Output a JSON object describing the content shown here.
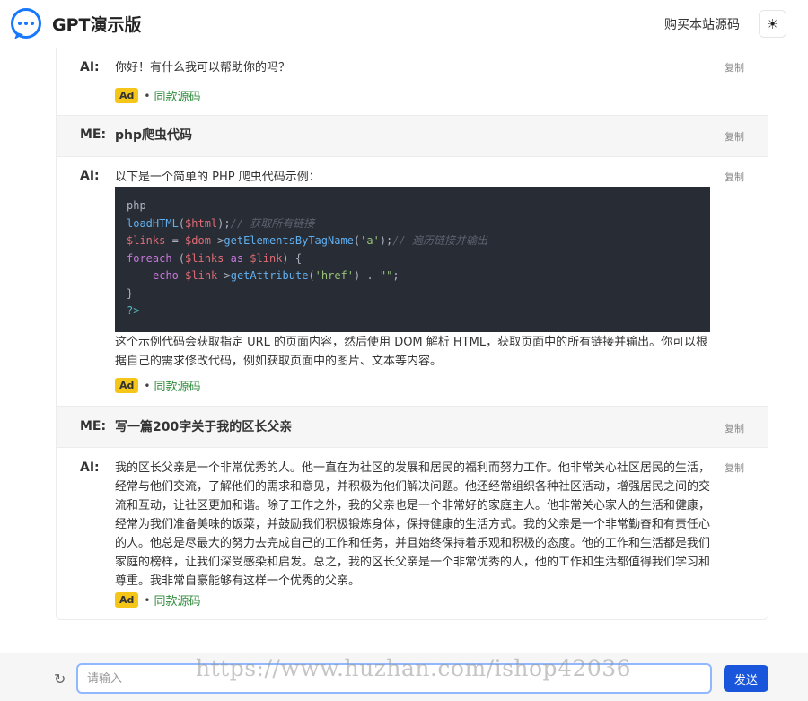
{
  "header": {
    "title": "GPT演示版",
    "buy_link": "购买本站源码",
    "theme_icon": "sun-icon"
  },
  "messages": [
    {
      "role": "AI:",
      "copy": "复制",
      "text": "你好！有什么我可以帮助你的吗？",
      "ad_badge": "Ad",
      "ad_dot": "•",
      "ad_link": "同款源码"
    },
    {
      "role": "ME:",
      "copy": "复制",
      "text": "php爬虫代码"
    },
    {
      "role": "AI:",
      "copy": "复制",
      "intro": "以下是一个简单的 PHP 爬虫代码示例：",
      "code": {
        "line1": "php",
        "line2_fn": "loadHTML",
        "line2_paren_open": "(",
        "line2_var": "$html",
        "line2_paren_close": ");",
        "line2_comment": "// 获取所有链接",
        "line3_var1": "$links",
        "line3_eq": " = ",
        "line3_var2": "$dom",
        "line3_arrow": "->",
        "line3_fn": "getElementsByTagName",
        "line3_open": "(",
        "line3_str": "'a'",
        "line3_close": ");",
        "line3_comment": "// 遍历链接并输出",
        "line4_kw": "foreach",
        "line4_open": " (",
        "line4_var1": "$links",
        "line4_as": " as ",
        "line4_var2": "$link",
        "line4_close": ") {",
        "line5_echo": "echo",
        "line5_var": "$link",
        "line5_arrow": "->",
        "line5_fn": "getAttribute",
        "line5_open": "(",
        "line5_str": "'href'",
        "line5_dot": ") . ",
        "line5_str2": "\"\"",
        "line5_end": ";",
        "line6": "}",
        "line7": "?>"
      },
      "outro": "这个示例代码会获取指定 URL 的页面内容，然后使用 DOM 解析 HTML，获取页面中的所有链接并输出。你可以根据自己的需求修改代码，例如获取页面中的图片、文本等内容。",
      "ad_badge": "Ad",
      "ad_dot": "•",
      "ad_link": "同款源码"
    },
    {
      "role": "ME:",
      "copy": "复制",
      "text": "写一篇200字关于我的区长父亲"
    },
    {
      "role": "AI:",
      "copy": "复制",
      "text": "我的区长父亲是一个非常优秀的人。他一直在为社区的发展和居民的福利而努力工作。他非常关心社区居民的生活，经常与他们交流，了解他们的需求和意见，并积极为他们解决问题。他还经常组织各种社区活动，增强居民之间的交流和互动，让社区更加和谐。除了工作之外，我的父亲也是一个非常好的家庭主人。他非常关心家人的生活和健康，经常为我们准备美味的饭菜，并鼓励我们积极锻炼身体，保持健康的生活方式。我的父亲是一个非常勤奋和有责任心的人。他总是尽最大的努力去完成自己的工作和任务，并且始终保持着乐观和积极的态度。他的工作和生活都是我们家庭的榜样，让我们深受感染和启发。总之，我的区长父亲是一个非常优秀的人，他的工作和生活都值得我们学习和尊重。我非常自豪能够有这样一个优秀的父亲。",
      "ad_badge": "Ad",
      "ad_dot": "•",
      "ad_link": "同款源码"
    }
  ],
  "input": {
    "placeholder": "请输入",
    "send_label": "发送",
    "refresh_icon": "refresh-icon"
  },
  "watermark": "https://www.huzhan.com/ishop42036",
  "colors": {
    "accent": "#1a56db",
    "logo": "#1677ff",
    "ad_badge": "#f5c518",
    "ad_link": "#2e8b3a",
    "code_bg": "#282c34"
  }
}
